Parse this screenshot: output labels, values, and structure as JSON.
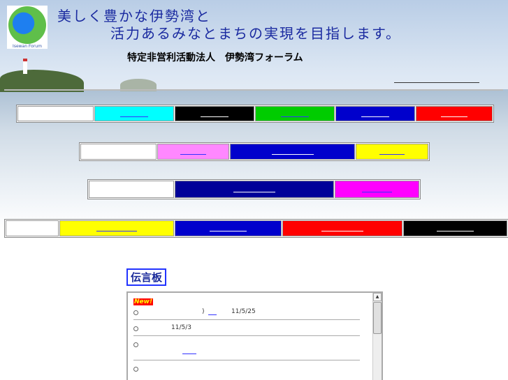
{
  "header": {
    "logo_text": "Isewan Forum",
    "slogan_line1": "美しく豊かな伊勢湾と",
    "slogan_line2": "活力あるみなとまちの実現を目指します。",
    "org_name": "特定非営利活動法人　伊勢湾フォーラム"
  },
  "nav_rows": [
    [
      {
        "color": "#ffffff"
      },
      {
        "color": "#00ffff"
      },
      {
        "color": "#000000"
      },
      {
        "color": "#00cc00"
      },
      {
        "color": "#0000cc"
      },
      {
        "color": "#ff0000"
      }
    ],
    [
      {
        "color": "#ffffff"
      },
      {
        "color": "#ff88ff"
      },
      {
        "color": "#0000cc"
      },
      {
        "color": "#ffff00"
      }
    ],
    [
      {
        "color": "#ffffff"
      },
      {
        "color": "#000099"
      },
      {
        "color": "#ff00ff"
      }
    ],
    [
      {
        "color": "#ffffff"
      },
      {
        "color": "#ffff00"
      },
      {
        "color": "#0000cc"
      },
      {
        "color": "#ff0000"
      },
      {
        "color": "#000000"
      }
    ]
  ],
  "board": {
    "title": "伝言板",
    "new_badge": "New!",
    "items": [
      {
        "paren": ")",
        "date": "11/5/25"
      },
      {
        "date": "11/5/3"
      },
      {},
      {}
    ]
  }
}
